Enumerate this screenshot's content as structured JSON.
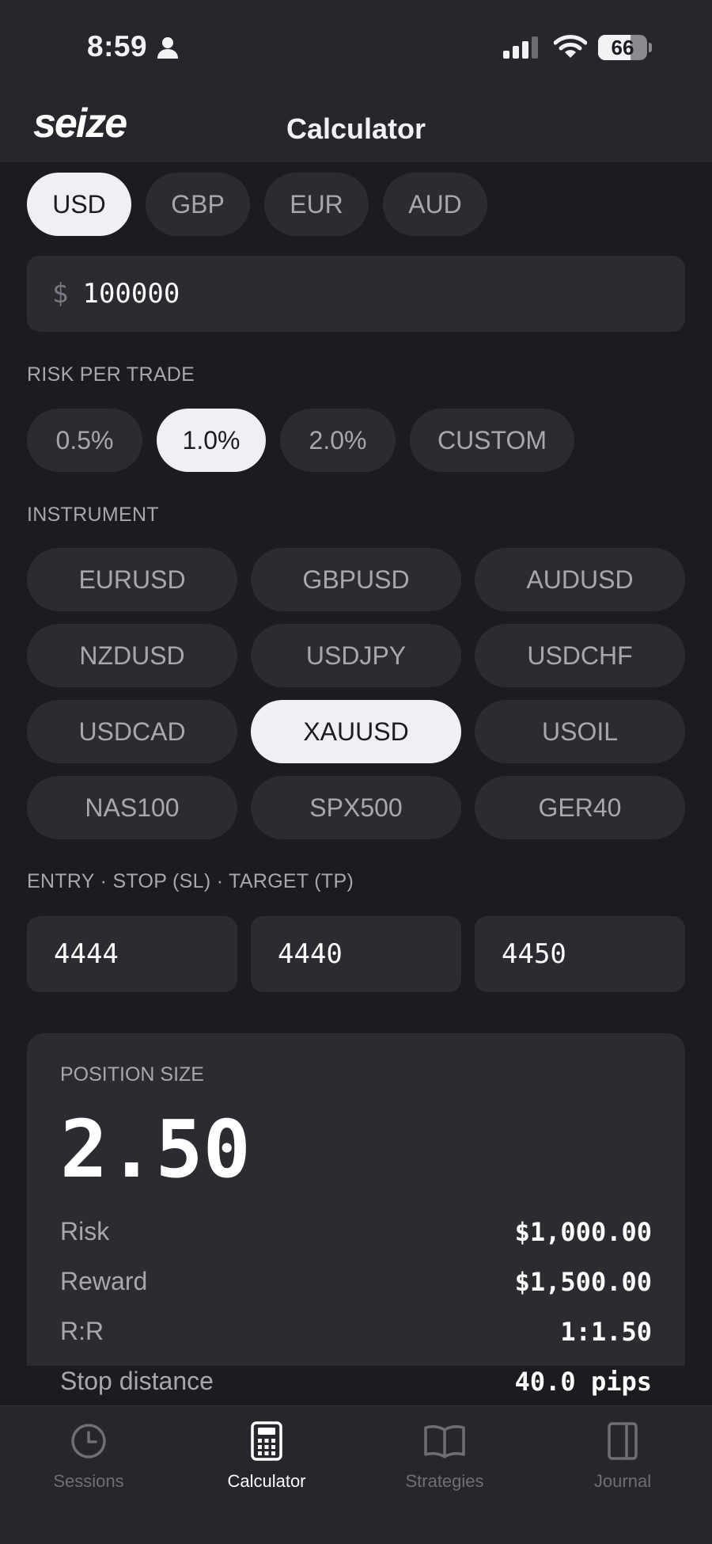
{
  "status_bar": {
    "time": "8:59",
    "battery": "66",
    "battery_level": 0.66
  },
  "header": {
    "logo": "seize",
    "title": "Calculator"
  },
  "currencies": [
    {
      "label": "USD",
      "active": true
    },
    {
      "label": "GBP",
      "active": false
    },
    {
      "label": "EUR",
      "active": false
    },
    {
      "label": "AUD",
      "active": false
    }
  ],
  "balance": {
    "symbol": "$",
    "value": "100000"
  },
  "risk": {
    "label": "RISK PER TRADE",
    "options": [
      {
        "label": "0.5%",
        "active": false
      },
      {
        "label": "1.0%",
        "active": true
      },
      {
        "label": "2.0%",
        "active": false
      },
      {
        "label": "CUSTOM",
        "active": false
      }
    ]
  },
  "instrument": {
    "label": "INSTRUMENT",
    "options": [
      {
        "label": "EURUSD",
        "active": false
      },
      {
        "label": "GBPUSD",
        "active": false
      },
      {
        "label": "AUDUSD",
        "active": false
      },
      {
        "label": "NZDUSD",
        "active": false
      },
      {
        "label": "USDJPY",
        "active": false
      },
      {
        "label": "USDCHF",
        "active": false
      },
      {
        "label": "USDCAD",
        "active": false
      },
      {
        "label": "XAUUSD",
        "active": true
      },
      {
        "label": "USOIL",
        "active": false
      },
      {
        "label": "NAS100",
        "active": false
      },
      {
        "label": "SPX500",
        "active": false
      },
      {
        "label": "GER40",
        "active": false
      }
    ]
  },
  "levels": {
    "label": "ENTRY · STOP (SL) · TARGET (TP)",
    "entry": "4444",
    "stop": "4440",
    "target": "4450"
  },
  "result": {
    "label": "POSITION SIZE",
    "value": "2.50",
    "rows": [
      {
        "label": "Risk",
        "value": "$1,000.00"
      },
      {
        "label": "Reward",
        "value": "$1,500.00"
      },
      {
        "label": "R:R",
        "value": "1:1.50"
      },
      {
        "label": "Stop distance",
        "value": "40.0 pips"
      }
    ]
  },
  "tabs": [
    {
      "label": "Sessions",
      "icon": "clock-icon",
      "active": false
    },
    {
      "label": "Calculator",
      "icon": "calculator-icon",
      "active": true
    },
    {
      "label": "Strategies",
      "icon": "book-icon",
      "active": false
    },
    {
      "label": "Journal",
      "icon": "journal-icon",
      "active": false
    }
  ]
}
